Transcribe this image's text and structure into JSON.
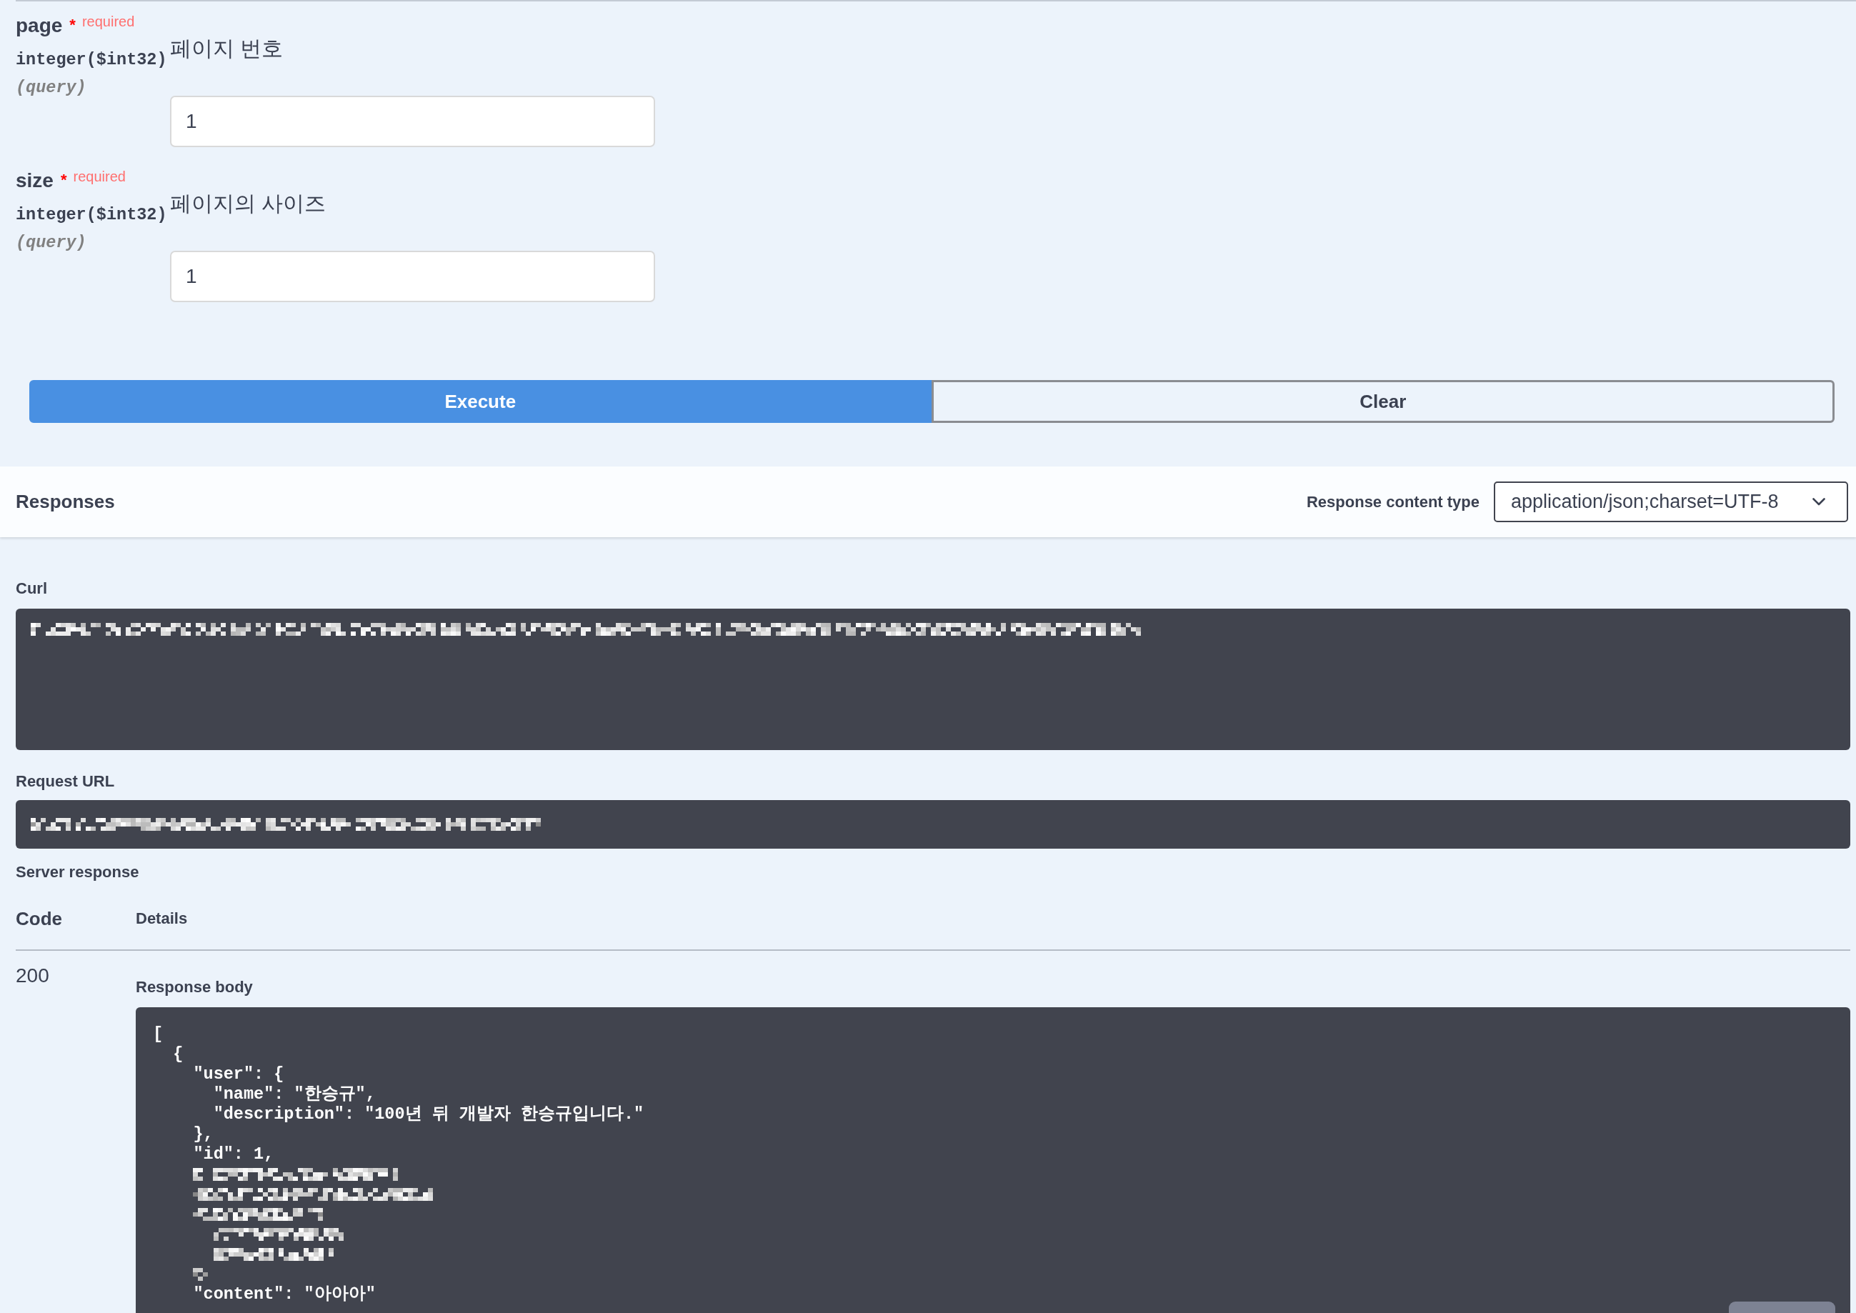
{
  "parameters": [
    {
      "name": "page",
      "required": true,
      "required_mark": "*",
      "required_label": "required",
      "type": "integer($int32)",
      "location": "(query)",
      "description": "페이지 번호",
      "value": "1"
    },
    {
      "name": "size",
      "required": true,
      "required_mark": "*",
      "required_label": "required",
      "type": "integer($int32)",
      "location": "(query)",
      "description": "페이지의 사이즈",
      "value": "1"
    }
  ],
  "actions": [
    {
      "label": "Execute",
      "kind": "primary"
    },
    {
      "label": "Clear",
      "kind": "secondary"
    }
  ],
  "responses": {
    "title": "Responses",
    "content_type_label": "Response content type",
    "content_type": "application/json;charset=UTF-8"
  },
  "curl": {
    "label": "Curl"
  },
  "request_url": {
    "label": "Request URL"
  },
  "server_response": {
    "label": "Server response",
    "columns": [
      "Code",
      "Details"
    ],
    "code": "200",
    "body_label": "Response body",
    "body_lines": [
      {
        "kind": "code",
        "text": "["
      },
      {
        "kind": "code",
        "text": "  {"
      },
      {
        "kind": "code",
        "text": "    \"user\": {"
      },
      {
        "kind": "code",
        "text": "      \"name\": \"한승규\","
      },
      {
        "kind": "code",
        "text": "      \"description\": \"100년 뒤 개발자 한승규입니다.\""
      },
      {
        "kind": "code",
        "text": "    },"
      },
      {
        "kind": "code",
        "text": "    \"id\": 1,"
      },
      {
        "kind": "redacted"
      },
      {
        "kind": "redacted"
      },
      {
        "kind": "redacted"
      },
      {
        "kind": "redacted"
      },
      {
        "kind": "redacted"
      },
      {
        "kind": "redacted"
      },
      {
        "kind": "code",
        "text": "    \"content\": \"아아아\""
      }
    ]
  }
}
